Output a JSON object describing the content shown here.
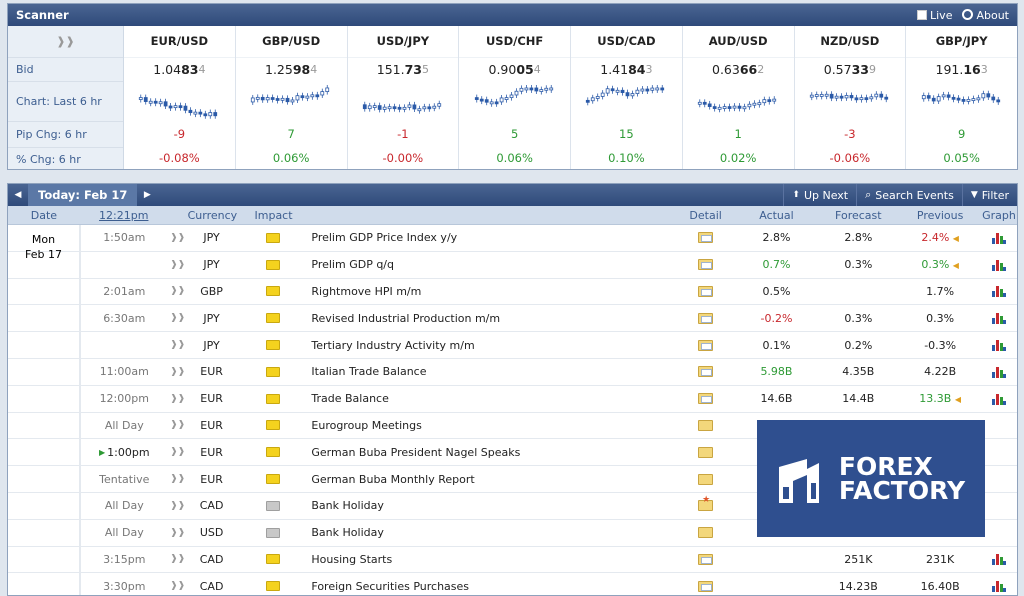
{
  "scanner": {
    "title": "Scanner",
    "live_label": "Live",
    "about_label": "About",
    "row_labels": [
      "Bid",
      "Chart: Last 6 hr",
      "Pip Chg: 6 hr",
      "% Chg: 6 hr"
    ],
    "pairs": [
      {
        "name": "EUR/USD",
        "bid_a": "1.04",
        "bid_b": "83",
        "bid_c": "4",
        "pip": "-9",
        "pct": "-0.08%",
        "dir": "neg"
      },
      {
        "name": "GBP/USD",
        "bid_a": "1.25",
        "bid_b": "98",
        "bid_c": "4",
        "pip": "7",
        "pct": "0.06%",
        "dir": "pos"
      },
      {
        "name": "USD/JPY",
        "bid_a": "151.",
        "bid_b": "73",
        "bid_c": "5",
        "pip": "-1",
        "pct": "-0.00%",
        "dir": "neg"
      },
      {
        "name": "USD/CHF",
        "bid_a": "0.90",
        "bid_b": "05",
        "bid_c": "4",
        "pip": "5",
        "pct": "0.06%",
        "dir": "pos"
      },
      {
        "name": "USD/CAD",
        "bid_a": "1.41",
        "bid_b": "84",
        "bid_c": "3",
        "pip": "15",
        "pct": "0.10%",
        "dir": "pos"
      },
      {
        "name": "AUD/USD",
        "bid_a": "0.63",
        "bid_b": "66",
        "bid_c": "2",
        "pip": "1",
        "pct": "0.02%",
        "dir": "pos"
      },
      {
        "name": "NZD/USD",
        "bid_a": "0.57",
        "bid_b": "33",
        "bid_c": "9",
        "pip": "-3",
        "pct": "-0.06%",
        "dir": "neg"
      },
      {
        "name": "GBP/JPY",
        "bid_a": "191.",
        "bid_b": "16",
        "bid_c": "3",
        "pip": "9",
        "pct": "0.05%",
        "dir": "pos"
      }
    ]
  },
  "calendar": {
    "today_label": "Today: Feb 17",
    "up_next": "Up Next",
    "search_events": "Search Events",
    "filter": "Filter",
    "columns": {
      "date": "Date",
      "time": "12:21pm",
      "currency": "Currency",
      "impact": "Impact",
      "detail": "Detail",
      "actual": "Actual",
      "forecast": "Forecast",
      "previous": "Previous",
      "graph": "Graph"
    },
    "day": "Mon",
    "date": "Feb 17",
    "events": [
      {
        "time": "1:50am",
        "cur": "JPY",
        "impact": "yellow",
        "event": "Prelim GDP Price Index y/y",
        "actual": "2.8%",
        "act_dir": "",
        "forecast": "2.8%",
        "previous": "2.4%",
        "prev_dir": "neg",
        "rev": true,
        "graph": true
      },
      {
        "time": "",
        "cur": "JPY",
        "impact": "yellow",
        "event": "Prelim GDP q/q",
        "actual": "0.7%",
        "act_dir": "pos",
        "forecast": "0.3%",
        "previous": "0.3%",
        "prev_dir": "pos",
        "rev": true,
        "graph": true
      },
      {
        "time": "2:01am",
        "cur": "GBP",
        "impact": "yellow",
        "event": "Rightmove HPI m/m",
        "actual": "0.5%",
        "act_dir": "",
        "forecast": "",
        "previous": "1.7%",
        "prev_dir": "",
        "rev": false,
        "graph": true
      },
      {
        "time": "6:30am",
        "cur": "JPY",
        "impact": "yellow",
        "event": "Revised Industrial Production m/m",
        "actual": "-0.2%",
        "act_dir": "neg",
        "forecast": "0.3%",
        "previous": "0.3%",
        "prev_dir": "",
        "rev": false,
        "graph": true
      },
      {
        "time": "",
        "cur": "JPY",
        "impact": "yellow",
        "event": "Tertiary Industry Activity m/m",
        "actual": "0.1%",
        "act_dir": "",
        "forecast": "0.2%",
        "previous": "-0.3%",
        "prev_dir": "",
        "rev": false,
        "graph": true
      },
      {
        "time": "11:00am",
        "cur": "EUR",
        "impact": "yellow",
        "event": "Italian Trade Balance",
        "actual": "5.98B",
        "act_dir": "pos",
        "forecast": "4.35B",
        "previous": "4.22B",
        "prev_dir": "",
        "rev": false,
        "graph": true
      },
      {
        "time": "12:00pm",
        "cur": "EUR",
        "impact": "yellow",
        "event": "Trade Balance",
        "actual": "14.6B",
        "act_dir": "",
        "forecast": "14.4B",
        "previous": "13.3B",
        "prev_dir": "pos",
        "rev": true,
        "graph": true
      },
      {
        "time": "All Day",
        "cur": "EUR",
        "impact": "yellow",
        "event": "Eurogroup Meetings",
        "actual": "",
        "act_dir": "",
        "forecast": "",
        "previous": "",
        "prev_dir": "",
        "rev": false,
        "graph": false
      },
      {
        "time": "1:00pm",
        "cur": "EUR",
        "impact": "yellow",
        "event": "German Buba President Nagel Speaks",
        "actual": "",
        "act_dir": "",
        "forecast": "",
        "previous": "",
        "prev_dir": "",
        "rev": false,
        "graph": false,
        "upnext": true
      },
      {
        "time": "Tentative",
        "cur": "EUR",
        "impact": "yellow",
        "event": "German Buba Monthly Report",
        "actual": "",
        "act_dir": "",
        "forecast": "",
        "previous": "",
        "prev_dir": "",
        "rev": false,
        "graph": false
      },
      {
        "time": "All Day",
        "cur": "CAD",
        "impact": "gray",
        "event": "Bank Holiday",
        "actual": "",
        "act_dir": "",
        "forecast": "",
        "previous": "",
        "prev_dir": "",
        "rev": false,
        "graph": false,
        "star": true
      },
      {
        "time": "All Day",
        "cur": "USD",
        "impact": "gray",
        "event": "Bank Holiday",
        "actual": "",
        "act_dir": "",
        "forecast": "",
        "previous": "",
        "prev_dir": "",
        "rev": false,
        "graph": false
      },
      {
        "time": "3:15pm",
        "cur": "CAD",
        "impact": "yellow",
        "event": "Housing Starts",
        "actual": "",
        "act_dir": "",
        "forecast": "251K",
        "previous": "231K",
        "prev_dir": "",
        "rev": false,
        "graph": true
      },
      {
        "time": "3:30pm",
        "cur": "CAD",
        "impact": "yellow",
        "event": "Foreign Securities Purchases",
        "actual": "",
        "act_dir": "",
        "forecast": "14.23B",
        "previous": "16.40B",
        "prev_dir": "",
        "rev": false,
        "graph": true
      }
    ]
  },
  "logo": {
    "line1": "FOREX",
    "line2": "FACTORY"
  },
  "colors": {
    "header": "#2f4a7a",
    "positive": "#2e9a35",
    "negative": "#c8282d",
    "logo_bg": "#2f4f8f"
  }
}
